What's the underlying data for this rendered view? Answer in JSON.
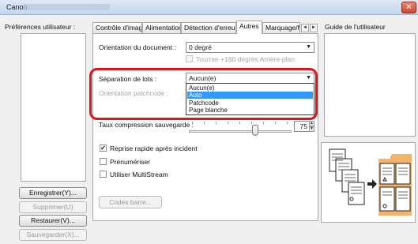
{
  "window": {
    "title": "Canon",
    "close_glyph": "✕"
  },
  "left_panel": {
    "label": "Préférences utilisateur :",
    "buttons": {
      "save": "Enregistrer(Y)...",
      "delete": "Supprimer(U)",
      "restore": "Restaurer(V)...",
      "backup": "Sauvegarder(X)..."
    }
  },
  "tabs": [
    {
      "label": "Contrôle d'image"
    },
    {
      "label": "Alimentation"
    },
    {
      "label": "Détection d'erreur"
    },
    {
      "label": "Autres"
    },
    {
      "label": "Marquage/Ma"
    }
  ],
  "tab_scroll": {
    "left": "◄",
    "right": "►"
  },
  "others_tab": {
    "doc_orientation": {
      "label": "Orientation du document :",
      "value": "0 degré"
    },
    "rotate_checkbox": {
      "label": "Tourner +180 degrés Arrière-plan",
      "checked": false
    },
    "batch_separation": {
      "label": "Séparation de lots :",
      "value": "Aucun(e)",
      "options": [
        "Aucun(e)",
        "Auto",
        "Patchcode",
        "Page blanche"
      ],
      "highlighted": "Auto"
    },
    "patchcode_orientation": {
      "label": "Orientation patchcode :"
    },
    "compression": {
      "label": "Taux compression sauvegarde :",
      "value": "75",
      "level": 75
    },
    "checkboxes": [
      {
        "label": "Reprise rapide après incident",
        "checked": true
      },
      {
        "label": "Prénumériser",
        "checked": false
      },
      {
        "label": "Utiliser MultiStream",
        "checked": false
      }
    ],
    "barcode_button": "Codes barre..."
  },
  "right_panel": {
    "guide_label": "Guide de l'utilisateur"
  },
  "colors": {
    "highlight_outline": "#e3131b",
    "selection": "#3399ff",
    "illustration_folder": "#f5b26b"
  },
  "icons": {
    "close": "close-icon",
    "dropdown": "chevron-down-icon",
    "illustration": "batch-separation-illustration-icon"
  }
}
